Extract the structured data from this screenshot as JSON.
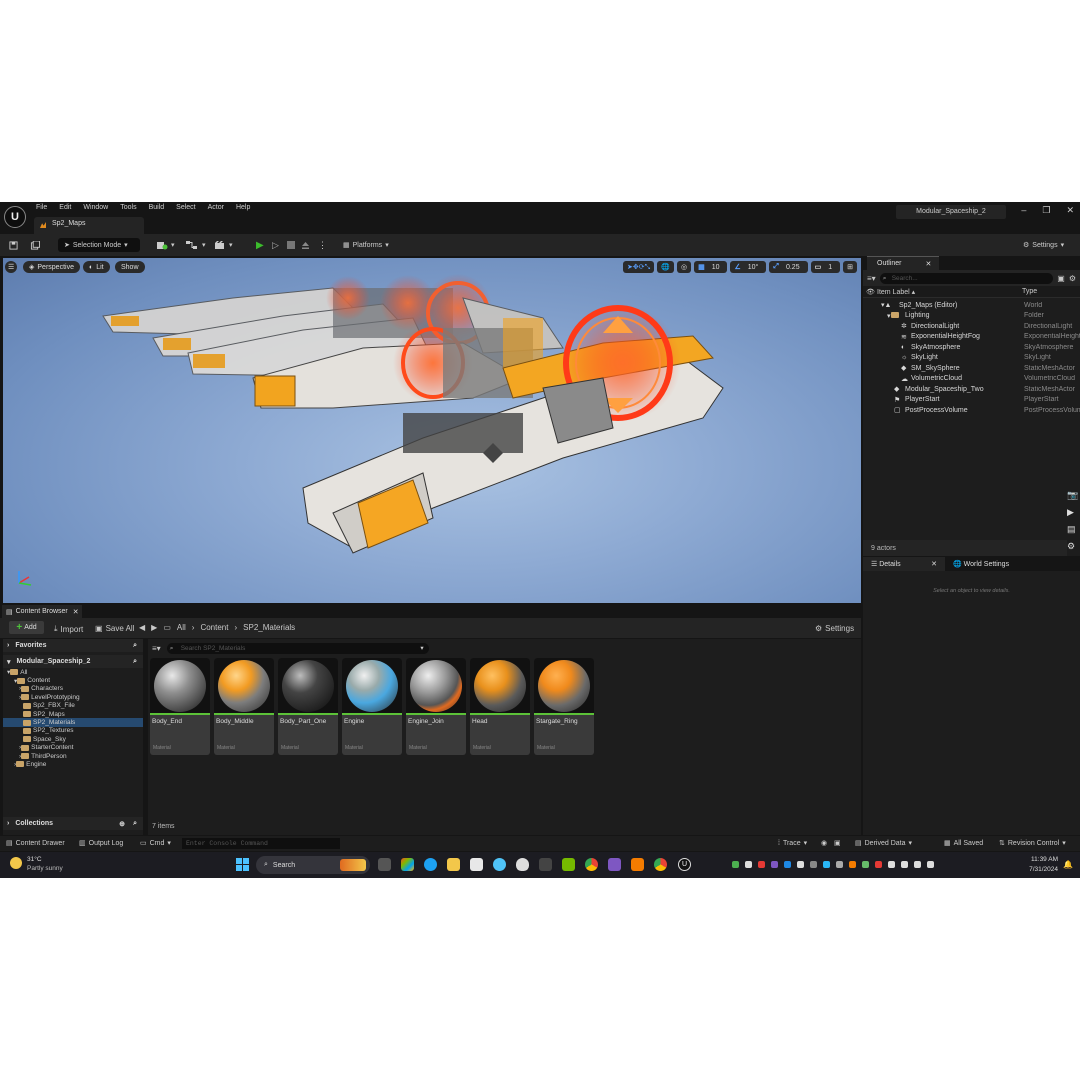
{
  "app": {
    "logo": "U",
    "menu": [
      "File",
      "Edit",
      "Window",
      "Tools",
      "Build",
      "Select",
      "Actor",
      "Help"
    ],
    "document_tab": "Sp2_Maps",
    "project_name": "Modular_Spaceship_2",
    "window_controls": [
      "–",
      "❐",
      "✕"
    ]
  },
  "toolbar": {
    "selection_mode": "Selection Mode",
    "platforms": "Platforms",
    "settings": "Settings"
  },
  "viewport": {
    "perspective": "Perspective",
    "lit": "Lit",
    "show": "Show",
    "grid_snap": "10",
    "rot_snap": "10°",
    "scale_snap": "0.25",
    "camera_speed": "1"
  },
  "outliner": {
    "title": "Outliner",
    "search_placeholder": "Search...",
    "col_label": "Item Label ▴",
    "col_type": "Type",
    "rows": [
      {
        "label": "Sp2_Maps (Editor)",
        "type": "World"
      },
      {
        "label": "Lighting",
        "type": "Folder"
      },
      {
        "label": "DirectionalLight",
        "type": "DirectionalLight"
      },
      {
        "label": "ExponentialHeightFog",
        "type": "ExponentialHeightFog"
      },
      {
        "label": "SkyAtmosphere",
        "type": "SkyAtmosphere"
      },
      {
        "label": "SkyLight",
        "type": "SkyLight"
      },
      {
        "label": "SM_SkySphere",
        "type": "StaticMeshActor"
      },
      {
        "label": "VolumetricCloud",
        "type": "VolumetricCloud"
      },
      {
        "label": "Modular_Spaceship_Two",
        "type": "StaticMeshActor"
      },
      {
        "label": "PlayerStart",
        "type": "PlayerStart"
      },
      {
        "label": "PostProcessVolume",
        "type": "PostProcessVolume"
      }
    ],
    "actor_count": "9 actors"
  },
  "details": {
    "tab_details": "Details",
    "tab_world": "World Settings",
    "empty_message": "Select an object to view details."
  },
  "content_browser": {
    "tab": "Content Browser",
    "add": "Add",
    "import": "Import",
    "save_all": "Save All",
    "path": [
      "All",
      "Content",
      "SP2_Materials"
    ],
    "settings": "Settings",
    "favorites": "Favorites",
    "project_root": "Modular_Spaceship_2",
    "tree": [
      "All",
      "Content",
      "Characters",
      "LevelPrototyping",
      "Sp2_FBX_File",
      "SP2_Maps",
      "SP2_Materials",
      "SP2_Textures",
      "Space_Sky",
      "StarterContent",
      "ThirdPerson",
      "Engine"
    ],
    "collections": "Collections",
    "search_placeholder": "Search SP2_Materials",
    "assets": [
      {
        "name": "Body_End",
        "type": "Material"
      },
      {
        "name": "Body_Middle",
        "type": "Material"
      },
      {
        "name": "Body_Part_One",
        "type": "Material"
      },
      {
        "name": "Engine",
        "type": "Material"
      },
      {
        "name": "Engine_Join",
        "type": "Material"
      },
      {
        "name": "Head",
        "type": "Material"
      },
      {
        "name": "Stargate_Ring",
        "type": "Material"
      }
    ],
    "item_count": "7 items"
  },
  "statusbar": {
    "content_drawer": "Content Drawer",
    "output_log": "Output Log",
    "cmd": "Cmd",
    "console_placeholder": "Enter Console Command",
    "trace": "Trace",
    "derived_data": "Derived Data",
    "all_saved": "All Saved",
    "revision_control": "Revision Control"
  },
  "taskbar": {
    "temperature": "31°C",
    "weather": "Partly sunny",
    "search": "Search",
    "time": "11:39 AM",
    "date": "7/31/2024"
  },
  "colors": {
    "accent_blue": "#264a70",
    "play_green": "#3cbd2c",
    "folder_tan": "#c9a468",
    "material_bar": "#5cc238"
  }
}
